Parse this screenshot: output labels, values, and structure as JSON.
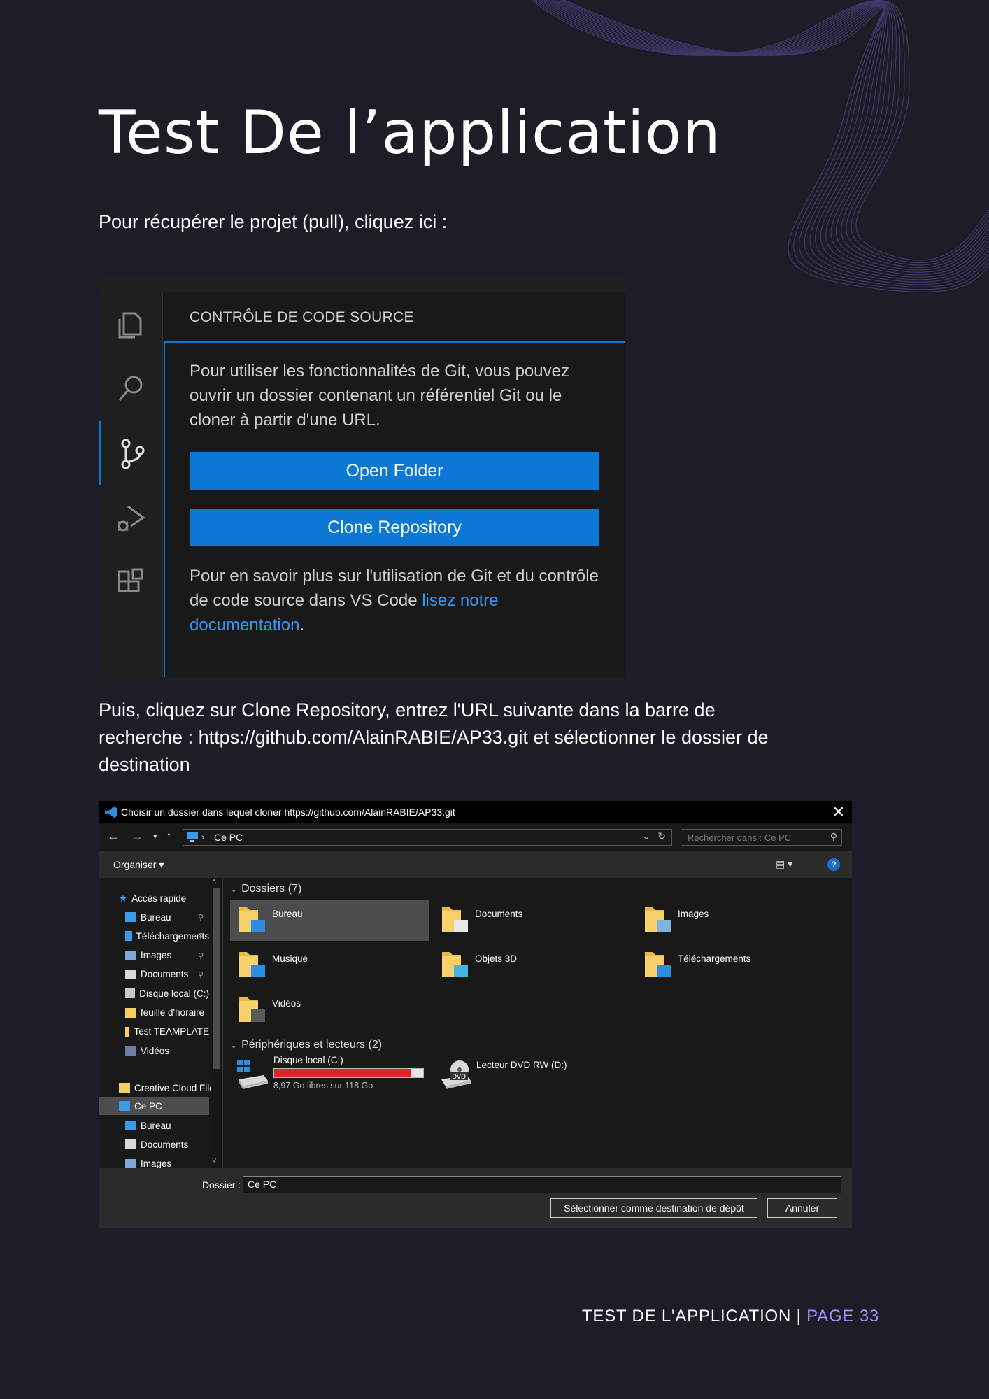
{
  "page": {
    "title": "Test De l’application",
    "p1": "Pour récupérer le projet (pull), cliquez ici :",
    "p2": "Puis, cliquez sur Clone Repository, entrez l'URL suivante dans la barre de recherche : https://github.com/AlainRABIE/AP33.git et sélectionner le dossier de destination",
    "footer_label": "TEST DE L'APPLICATION |",
    "footer_page": "PAGE 33",
    "accent_color": "#a78bfa"
  },
  "vscode": {
    "panel_title": "CONTRÔLE DE CODE SOURCE",
    "intro": "Pour utiliser les fonctionnalités de Git, vous pouvez ouvrir un dossier contenant un référentiel Git ou le cloner à partir d'une URL.",
    "open_folder": "Open Folder",
    "clone_repository": "Clone Repository",
    "more_text": "Pour en savoir plus sur l'utilisation de Git et du contrôle de code source dans VS Code ",
    "more_link": "lisez notre documentation",
    "more_end": ".",
    "accent": "#0b78d5",
    "activity_icons": [
      "files-icon",
      "search-icon",
      "source-control-icon",
      "run-debug-icon",
      "extensions-icon"
    ]
  },
  "dialog": {
    "title": "Choisir un dossier dans lequel cloner https://github.com/AlainRABIE/AP33.git",
    "close": "✕",
    "address": "Ce PC",
    "search_placeholder": "Rechercher dans : Ce PC",
    "organize": "Organiser ▾",
    "nav": {
      "quick_access": "Accès rapide",
      "quick_items": [
        "Bureau",
        "Téléchargements",
        "Images",
        "Documents",
        "Disque local (C:)",
        "feuille d'horaire",
        "Test TEAMPLATE",
        "Vidéos"
      ],
      "creative_cloud": "Creative Cloud Files",
      "this_pc": "Ce PC",
      "pc_items": [
        "Bureau",
        "Documents",
        "Images"
      ]
    },
    "folders_header": "Dossiers (7)",
    "folders": [
      "Bureau",
      "Documents",
      "Images",
      "Musique",
      "Objets 3D",
      "Téléchargements",
      "Vidéos"
    ],
    "devices_header": "Périphériques et lecteurs (2)",
    "drive_c": {
      "name": "Disque local (C:)",
      "free": "8,97 Go libres sur 118 Go",
      "used_fraction": 0.92
    },
    "drive_d": {
      "name": "Lecteur DVD RW (D:)"
    },
    "folder_label": "Dossier :",
    "folder_value": "Ce PC",
    "select_button": "Sélectionner comme destination de dépôt",
    "cancel_button": "Annuler"
  }
}
